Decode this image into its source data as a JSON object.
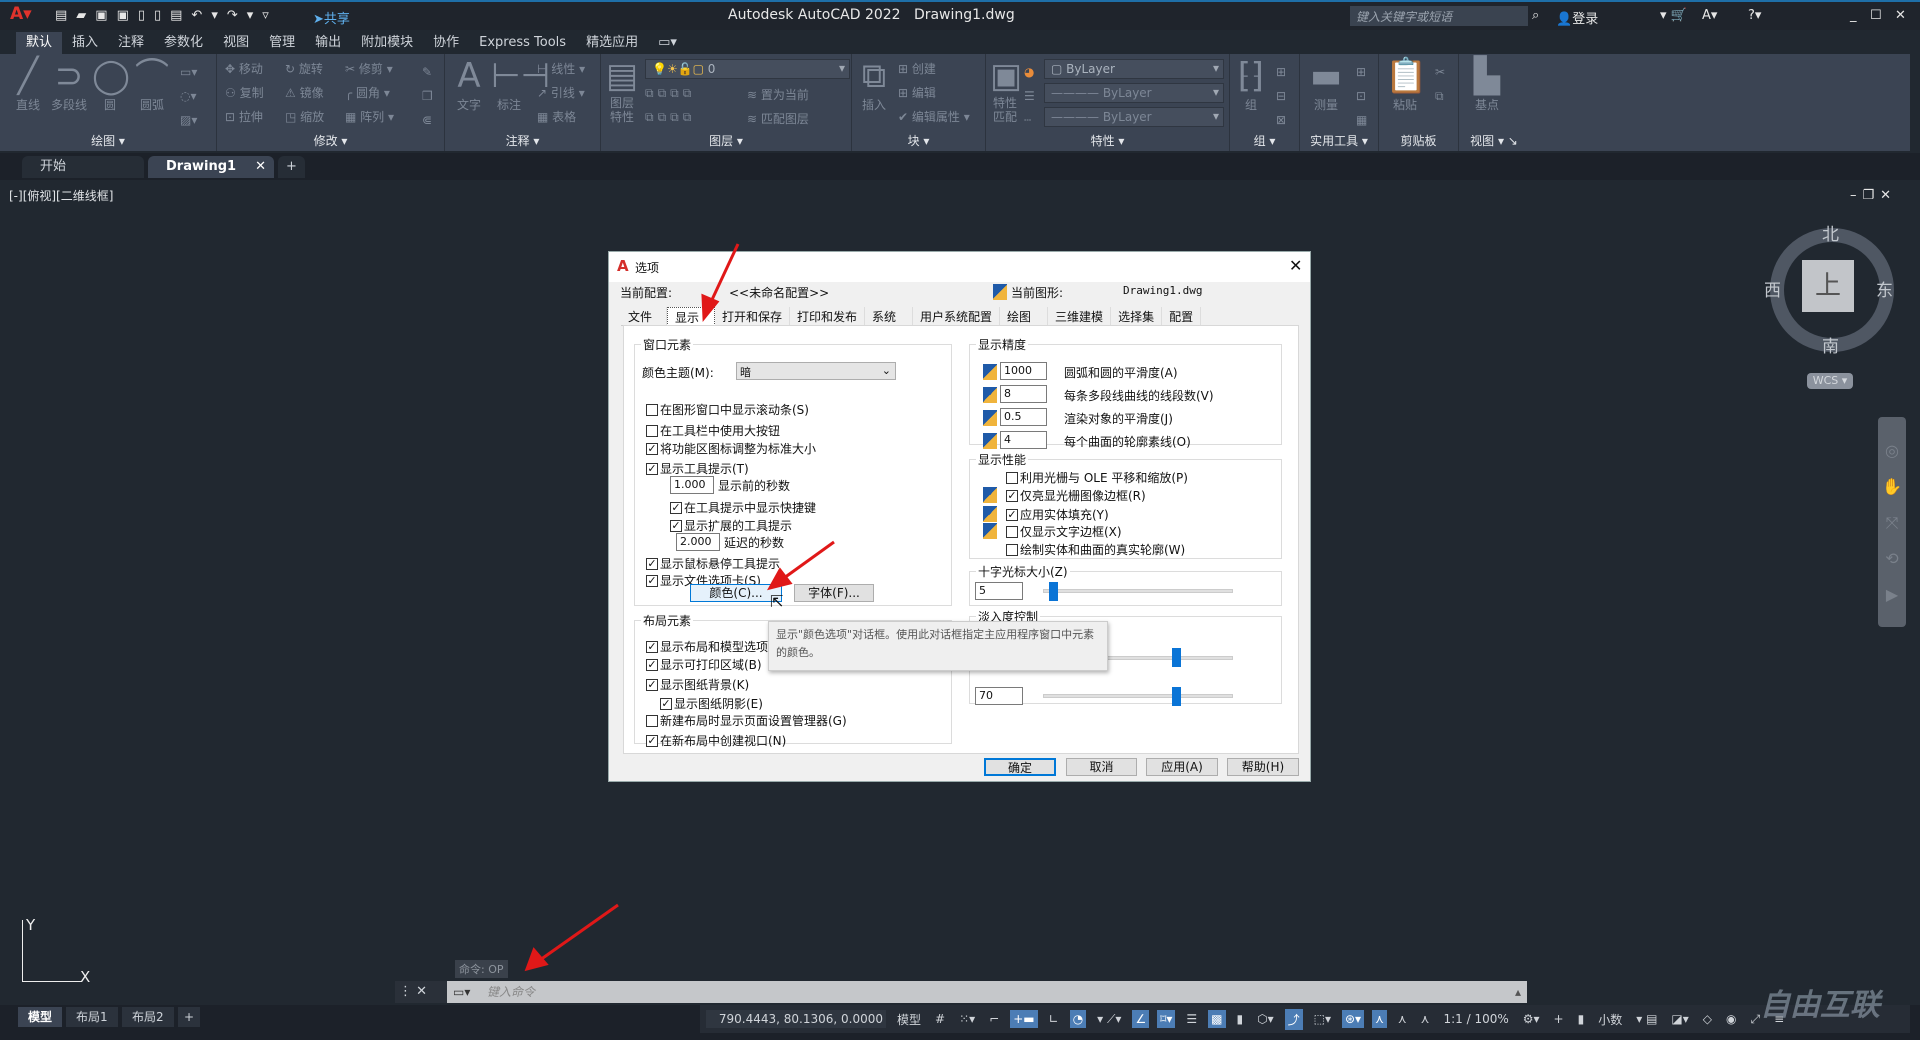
{
  "titlebar": {
    "app_title": "Autodesk AutoCAD 2022",
    "doc_title": "Drawing1.dwg",
    "share": "共享",
    "search_placeholder": "键入关键字或短语",
    "login": "登录"
  },
  "menu_tabs": [
    "默认",
    "插入",
    "注释",
    "参数化",
    "视图",
    "管理",
    "输出",
    "附加模块",
    "协作",
    "Express Tools",
    "精选应用"
  ],
  "ribbon": {
    "draw": {
      "label": "绘图",
      "items": [
        "直线",
        "多段线",
        "圆",
        "圆弧"
      ]
    },
    "modify": {
      "label": "修改",
      "items": [
        "移动",
        "旋转",
        "修剪",
        "复制",
        "镜像",
        "圆角",
        "拉伸",
        "缩放",
        "阵列"
      ]
    },
    "annotate": {
      "label": "注释",
      "items": [
        "文字",
        "标注",
        "线性",
        "引线",
        "表格"
      ]
    },
    "layers": {
      "label": "图层",
      "items": [
        "图层特性",
        "置为当前",
        "匹配图层"
      ],
      "layer_value": "0"
    },
    "block": {
      "label": "块",
      "items": [
        "插入",
        "创建",
        "编辑",
        "编辑属性"
      ]
    },
    "properties": {
      "label": "特性",
      "items": [
        "特性匹配"
      ],
      "color": "ByLayer",
      "linetype": "ByLayer",
      "lineweight": "ByLayer"
    },
    "group": {
      "label": "组",
      "items": [
        "组"
      ]
    },
    "utilities": {
      "label": "实用工具",
      "items": [
        "测量"
      ]
    },
    "clipboard": {
      "label": "剪贴板",
      "items": [
        "粘贴"
      ]
    },
    "view": {
      "label": "视图",
      "items": [
        "基点"
      ]
    }
  },
  "file_tabs": [
    "开始",
    "Drawing1"
  ],
  "viewport_label": "[-][俯视][二维线框]",
  "dialog": {
    "title": "选项",
    "profile_label": "当前配置:",
    "profile_value": "<<未命名配置>>",
    "drawing_label": "当前图形:",
    "drawing_value": "Drawing1.dwg",
    "tabs": [
      "文件",
      "显示",
      "打开和保存",
      "打印和发布",
      "系统",
      "用户系统配置",
      "绘图",
      "三维建模",
      "选择集",
      "配置"
    ],
    "active_tab": "显示",
    "window_elements": {
      "label": "窗口元素",
      "theme_label": "颜色主题(M):",
      "theme_value": "暗",
      "checks": [
        {
          "label": "在图形窗口中显示滚动条(S)",
          "checked": false
        },
        {
          "label": "在工具栏中使用大按钮",
          "checked": false
        },
        {
          "label": "将功能区图标调整为标准大小",
          "checked": true
        },
        {
          "label": "显示工具提示(T)",
          "checked": true
        },
        {
          "label": "在工具提示中显示快捷键",
          "checked": true
        },
        {
          "label": "显示扩展的工具提示",
          "checked": true
        },
        {
          "label": "显示鼠标悬停工具提示",
          "checked": true
        },
        {
          "label": "显示文件选项卡(S)",
          "checked": true
        }
      ],
      "delay_before": "1.000",
      "delay_before_label": "显示前的秒数",
      "delay_ext": "2.000",
      "delay_ext_label": "延迟的秒数",
      "colors_button": "颜色(C)...",
      "fonts_button": "字体(F)..."
    },
    "layout_elements": {
      "label": "布局元素",
      "checks": [
        {
          "label": "显示布局和模型选项卡(L)",
          "checked": true
        },
        {
          "label": "显示可打印区域(B)",
          "checked": true
        },
        {
          "label": "显示图纸背景(K)",
          "checked": true
        },
        {
          "label": "显示图纸阴影(E)",
          "checked": true
        },
        {
          "label": "新建布局时显示页面设置管理器(G)",
          "checked": false
        },
        {
          "label": "在新布局中创建视口(N)",
          "checked": true
        }
      ]
    },
    "display_resolution": {
      "label": "显示精度",
      "rows": [
        {
          "value": "1000",
          "label": "圆弧和圆的平滑度(A)"
        },
        {
          "value": "8",
          "label": "每条多段线曲线的线段数(V)"
        },
        {
          "value": "0.5",
          "label": "渲染对象的平滑度(J)"
        },
        {
          "value": "4",
          "label": "每个曲面的轮廓素线(O)"
        }
      ]
    },
    "display_performance": {
      "label": "显示性能",
      "checks": [
        {
          "label": "利用光栅与 OLE 平移和缩放(P)",
          "checked": false
        },
        {
          "label": "仅亮显光栅图像边框(R)",
          "checked": true
        },
        {
          "label": "应用实体填充(Y)",
          "checked": true
        },
        {
          "label": "仅显示文字边框(X)",
          "checked": false
        },
        {
          "label": "绘制实体和曲面的真实轮廓(W)",
          "checked": false
        }
      ]
    },
    "crosshair": {
      "label": "十字光标大小(Z)",
      "value": "5",
      "percent": 5
    },
    "fade": {
      "label": "淡入度控制",
      "xref_percent": 70,
      "inplace_value": "70",
      "inplace_percent": 70
    },
    "tooltip": "显示\"颜色选项\"对话框。使用此对话框指定主应用程序窗口中元素的颜色。",
    "buttons": {
      "ok": "确定",
      "cancel": "取消",
      "apply": "应用(A)",
      "help": "帮助(H)"
    }
  },
  "compass": {
    "north": "北",
    "south": "南",
    "east": "东",
    "west": "西",
    "top": "上",
    "wcs": "WCS"
  },
  "ucs": {
    "x": "X",
    "y": "Y"
  },
  "command": {
    "history": "命令: OP",
    "placeholder": "键入命令"
  },
  "layout_tabs": [
    "模型",
    "布局1",
    "布局2"
  ],
  "status": {
    "coords": "790.4443, 80.1306, 0.0000",
    "model": "模型",
    "scale": "1:1 / 100%",
    "units": "小数"
  },
  "watermark": "自由互联",
  "colors": {
    "accent": "#0078d7",
    "ribbon": "#3b4453",
    "canvas": "#212830",
    "annotation_arrow": "#e01818"
  }
}
